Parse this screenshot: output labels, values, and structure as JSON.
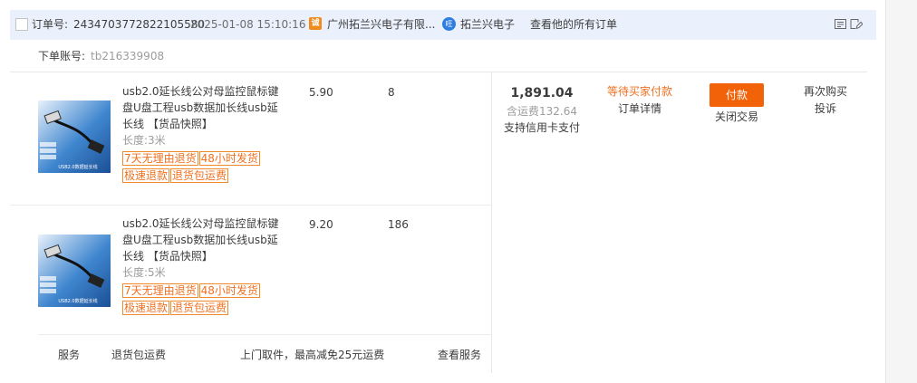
{
  "header": {
    "order_no_label": "订单号:",
    "order_no": "2434703772822105580",
    "order_time": "2025-01-08 15:10:16",
    "shop_name": "广州拓兰兴电子有限...",
    "seller_name": "拓兰兴电子",
    "view_all_orders": "查看他的所有订单"
  },
  "sub_account": {
    "label": "下单账号:",
    "value": "tb216339908"
  },
  "items": [
    {
      "title": "usb2.0延长线公对母监控鼠标键盘U盘工程usb数据加长线usb延长线 【货品快照】",
      "spec": "长度:3米",
      "tags": [
        "7天无理由退货",
        "48小时发货",
        "极速退款",
        "退货包运费"
      ],
      "price": "5.90",
      "qty": "8"
    },
    {
      "title": "usb2.0延长线公对母监控鼠标键盘U盘工程usb数据加长线usb延长线 【货品快照】",
      "spec": "长度:5米",
      "tags": [
        "7天无理由退货",
        "48小时发货",
        "极速退款",
        "退货包运费"
      ],
      "price": "9.20",
      "qty": "186"
    }
  ],
  "service": {
    "label": "服务",
    "name": "退货包运费",
    "desc": "上门取件，最高减免25元运费",
    "view": "查看服务"
  },
  "totals": {
    "total": "1,891.04",
    "shipping": "含运费132.64",
    "credit": "支持信用卡支付"
  },
  "status": {
    "state": "等待买家付款",
    "detail": "订单详情"
  },
  "actions": {
    "pay": "付款",
    "close": "关闭交易",
    "rebuy": "再次购买",
    "complain": "投诉"
  },
  "product_image_text": [
    "USB2.0数据延长线"
  ],
  "colors": {
    "header_bg": "#eaf1fc",
    "accent": "#f26309",
    "status": "#f07020"
  },
  "icons": [
    "checkbox",
    "shop-icon",
    "wangwang-icon",
    "note-icon",
    "edit-icon"
  ]
}
